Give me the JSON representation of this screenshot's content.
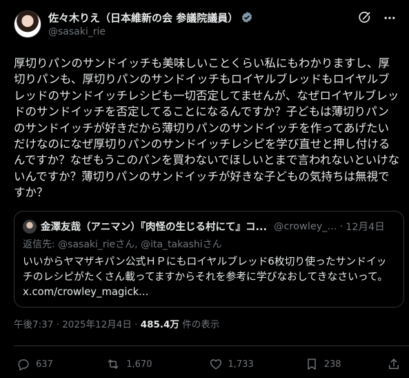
{
  "author": {
    "display_name": "佐々木りえ（日本維新の会 参議院議員）",
    "handle": "@sasaki_rie"
  },
  "post": {
    "text": "厚切りパンのサンドイッチも美味しいことくらい私にもわかりますし、厚切りパンも、厚切りパンのサンドイッチもロイヤルブレッドもロイヤルブレッドのサンドイッチレシピも一切否定してませんが、なぜロイヤルブレッドのサンドイッチを否定してることになるんですか？子どもは薄切りパンのサンドイッチが好きだから薄切りパンのサンドイッチを作ってあげたいだけなのになぜ厚切りパンのサンドイッチレシピを学び直せと押し付けるんですか？なぜもうこのパンを買わないでほしいとまで言われないといけないんですか？薄切りパンのサンドイッチが好きな子どもの気持ちは無視ですか？",
    "time": "午後7:37 · 2025年12月4日",
    "views_count": "485.4万",
    "views_label": "件の表示"
  },
  "quote": {
    "display_name": "金澤友哉（アニマン）『肉怪の生じる村にて』コ...",
    "handle": "@crowley_...",
    "date": "12月4日",
    "reply_prefix": "返信先: ",
    "reply_mention_1": "@sasaki_rie",
    "reply_suffix_1": "さん, ",
    "reply_mention_2": "@ita_takashi",
    "reply_suffix_2": "さん",
    "text": "いいからヤマザキパン公式ＨＰにもロイヤルブレッド6枚切り使ったサンドイッチのレシピがたくさん載ってますからそれを参考に学びなおしてきなさいって。",
    "link": "x.com/crowley_magick..."
  },
  "actions": {
    "replies": "637",
    "reposts": "1,670",
    "likes": "1,733",
    "bookmarks": "238"
  },
  "colors": {
    "background": "#000000",
    "text": "#e7e9ea",
    "muted": "#71767b",
    "border": "#2f3336",
    "verified": "#829aab"
  },
  "icons": [
    "verified-badge-icon",
    "grok-icon",
    "more-icon",
    "reply-icon",
    "repost-icon",
    "like-icon",
    "bookmark-icon",
    "share-icon"
  ]
}
